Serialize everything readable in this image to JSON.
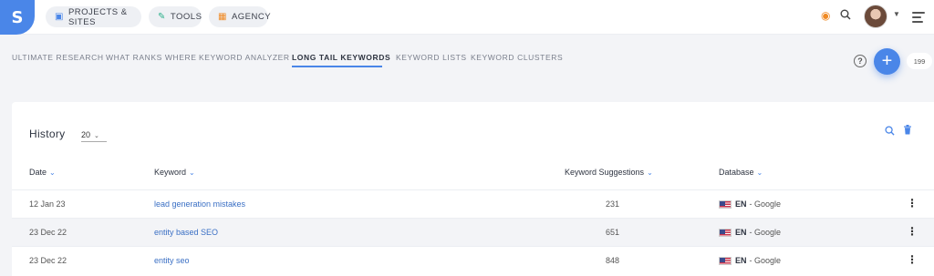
{
  "app": {
    "logo_text": "S"
  },
  "topnav": {
    "items": [
      {
        "label": "PROJECTS & SITES",
        "icon": "briefcase-icon"
      },
      {
        "label": "TOOLS",
        "icon": "tools-icon"
      },
      {
        "label": "AGENCY",
        "icon": "agency-icon"
      }
    ]
  },
  "subnav": {
    "tabs": [
      {
        "label": "ULTIMATE RESEARCH"
      },
      {
        "label": "WHAT RANKS WHERE"
      },
      {
        "label": "KEYWORD ANALYZER"
      },
      {
        "label": "LONG TAIL KEYWORDS",
        "active": true
      },
      {
        "label": "KEYWORD LISTS"
      },
      {
        "label": "KEYWORD CLUSTERS"
      }
    ],
    "help": "?",
    "add": "+",
    "count": "199"
  },
  "history": {
    "title": "History",
    "page_size": "20",
    "columns": {
      "date": "Date",
      "keyword": "Keyword",
      "suggestions": "Keyword Suggestions",
      "database": "Database"
    },
    "rows": [
      {
        "date": "12 Jan 23",
        "keyword": "lead generation mistakes",
        "suggestions": "231",
        "lang": "EN",
        "engine": "- Google"
      },
      {
        "date": "23 Dec 22",
        "keyword": "entity based SEO",
        "suggestions": "651",
        "lang": "EN",
        "engine": "- Google"
      },
      {
        "date": "23 Dec 22",
        "keyword": "entity seo",
        "suggestions": "848",
        "lang": "EN",
        "engine": "- Google"
      }
    ]
  },
  "colors": {
    "accent": "#4a86e8",
    "link": "#3a6fc4",
    "background": "#f3f4f7"
  }
}
